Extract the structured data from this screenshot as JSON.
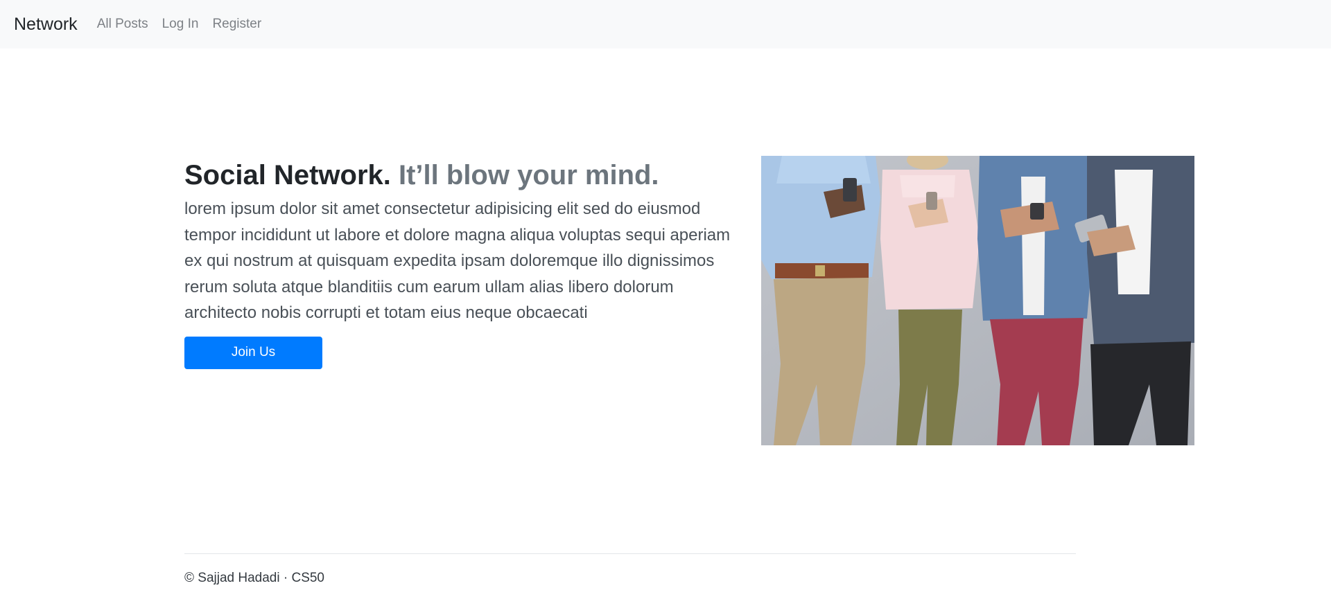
{
  "navbar": {
    "brand": "Network",
    "links": [
      {
        "label": "All Posts"
      },
      {
        "label": "Log In"
      },
      {
        "label": "Register"
      }
    ]
  },
  "hero": {
    "title_primary": "Social Network.",
    "title_secondary": "It’ll blow your mind.",
    "lead": "lorem ipsum dolor sit amet consectetur adipisicing elit sed do eiusmod tempor incididunt ut labore et dolore magna aliqua voluptas sequi aperiam ex qui nostrum at quisquam expedita ipsam doloremque illo dignissimos rerum soluta atque blanditiis cum earum ullam alias libero dolorum architecto nobis corrupti et totam eius neque obcaecati",
    "cta_label": "Join Us"
  },
  "footer": {
    "text": "© Sajjad Hadadi · CS50"
  },
  "colors": {
    "navbar_bg": "#f8f9fa",
    "primary": "#007bff",
    "muted": "#6c757d"
  }
}
